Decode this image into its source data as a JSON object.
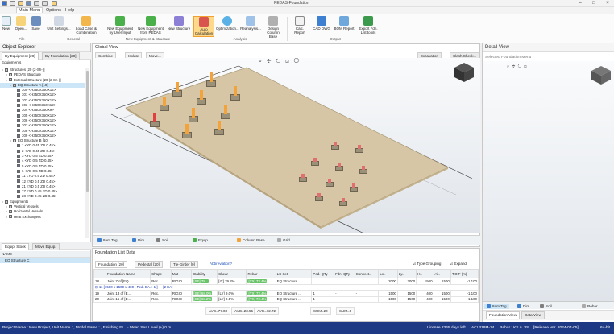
{
  "app": {
    "title": "PEDAS-Foundation"
  },
  "menu": [
    "Main Menu",
    "Options",
    "Help"
  ],
  "ribbon": {
    "buttons": [
      "New",
      "Open...",
      "Save",
      "Unit Settings...",
      "Load Case & Combination",
      "New Equipment by User Input",
      "New Equipment from PEDAS",
      "New Structure",
      "Auto Calculation",
      "Optimization...",
      "Reanalysis...",
      "Design Column Base",
      "Calc. Report",
      "CAD DWG",
      "BOM Report",
      "Export Fdn. List to xls"
    ],
    "groups": [
      "File",
      "General",
      "New Equipment & Structure",
      "Analysis",
      "Output"
    ]
  },
  "explorer": {
    "title": "Object Explorer",
    "tabs": [
      "By Equipment [20]",
      "By Foundation [20]"
    ],
    "section": "Equipments",
    "tree": [
      "Structures [20 (2-Sh-)]",
      "PEDAS Structure",
      "External Structure [20 (2-Sh-)]",
      "EQ Structure A [10]",
      "300 <H350X350X12>",
      "301 <H350X350X12>",
      "302 <H350X350X12>",
      "303 <H350X350X12>",
      "304 <H350X350X9>",
      "305 <H350X350X12>",
      "306 <H350X350X12>",
      "307 <H350X350X12>",
      "308 <H350X350X12>",
      "309 <H350X350X12>",
      "EQ Structure B [10]",
      "1 <YD 0.45 ZD 0.45>",
      "2 <YD 0.45 ZD 0.45>",
      "3 <YD 0.5 ZD 0.45>",
      "4 <YD 0.5 ZD 0.45>",
      "5 <YD 0.5 ZD 0.45>",
      "6 <YD 0.5 ZD 0.45>",
      "11 <YD 0.5 ZD 0.45>",
      "12 <YD 0.5 ZD 0.45>",
      "21 <YD 0.5 ZD 0.45>",
      "27 <YD 0.45 ZD 0.45>",
      "28 <YD 0.45 ZD 0.45>",
      "Equipments",
      "Vertical Vessels",
      "Horizontal Vessels",
      "Heat Exchangers"
    ],
    "bottom_tabs": [
      "Equip. Stock",
      "Move Equip."
    ],
    "name_header": "NAME",
    "name_row": "EQ Structure C"
  },
  "global_view": {
    "title": "Global View",
    "toolbar": [
      "Combine",
      "Isolate",
      "Move..."
    ],
    "right_buttons": [
      "Excavation",
      "Clash Check..."
    ],
    "bottom_tabs": [
      "Item Tag",
      "Dim.",
      "Soil",
      "Equip.",
      "Column Base",
      "Grid"
    ]
  },
  "list": {
    "title": "Foundation List Data",
    "tabs": [
      "Foundation [20]",
      "Pedestal [20]",
      "Tie-Girder [0]",
      "Abbreviation?"
    ],
    "options": [
      "Type Grouping",
      "Expand"
    ],
    "headers": [
      "",
      "Foundation Name",
      "Shape",
      "Mat",
      "Stability",
      "Shear",
      "Rebar",
      "LC Set",
      "Ped. QTy",
      "Fdn. QTy",
      "Connect..",
      "Lx..",
      "Ly..",
      "H..",
      "Al..",
      "T.O.F (m)"
    ],
    "rows": [
      {
        "no": "18",
        "name": "Joint 7 of [EQ...",
        "shape": "Rec.",
        "mat": "RIGID",
        "stab": "[SE] 78...",
        "shear": "[IX] 29.2%",
        "rebar": "[YX] 72.4%",
        "lc": "EQ Structure ...",
        "ped": "",
        "fdn": "",
        "conn": "",
        "lx": "2000",
        "ly": "2000",
        "h": "1500",
        "al": "1500",
        "tof": "-1.100"
      },
      {
        "group": "⊟ 11 [1500 x 1500 x 400 , Ped. EA. : 1 ] — [2 EA]"
      },
      {
        "no": "19",
        "name": "Joint 13 of [E...",
        "shape": "Rec.",
        "mat": "RIGID",
        "stab": "[SE] 68.0%",
        "shear": "[LY] 9.0%",
        "rebar": "[YX] 72.4%",
        "lc": "EQ Structure ...",
        "ped": "1",
        "fdn": "-",
        "conn": "-",
        "lx": "1500",
        "ly": "1500",
        "h": "400",
        "al": "1500",
        "tof": "-1.100"
      },
      {
        "no": "20",
        "name": "Joint 15 of [E...",
        "shape": "Rec.",
        "mat": "RIGID",
        "stab": "[SE] 68.2%",
        "shear": "[LY] 9.1%",
        "rebar": "[YX] 72.4%",
        "lc": "EQ Structure ...",
        "ped": "1",
        "fdn": "-",
        "conn": "-",
        "lx": "1500",
        "ly": "1500",
        "h": "400",
        "al": "1500",
        "tof": "-1.100"
      }
    ],
    "averages": [
      "AVG=77.03",
      "AVG=23.55",
      "AVG=72.72",
      "SUM=20",
      "SUM=0"
    ]
  },
  "detail": {
    "title": "Detail View",
    "menu": "Selected Foundation Menu",
    "bottom_tabs": [
      "Item Tag",
      "Dim.",
      "Soil",
      "Rebar"
    ],
    "view_tabs": [
      "Foundation View",
      "Data View"
    ]
  },
  "status": {
    "left": "Project Name : New Project, Unit Name : , Model Name : , Finishing EL. = Mean Sea Level (+) 0 m",
    "license": "License 2365 days left",
    "code": "ACI 318M-14",
    "rebar": "Rebar : KS & JIS",
    "release": "[Release Ver. 2024-07-05]",
    "bits": "64-bit"
  },
  "colors": {
    "accent": "#1f3a85",
    "pad": "#d6c6a6",
    "highlight": "#ffd98a",
    "pill": "#6ac46a"
  }
}
